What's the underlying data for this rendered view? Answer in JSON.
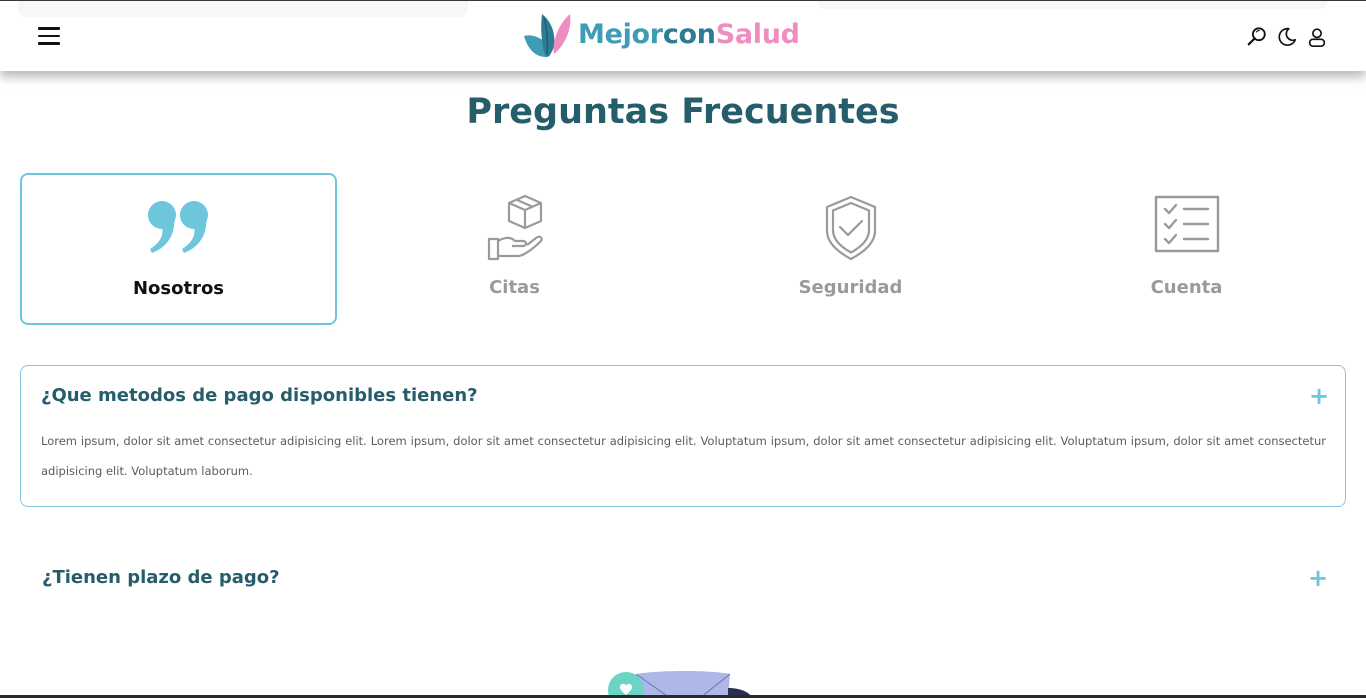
{
  "header": {
    "menu_icon": "hamburger-menu-icon",
    "logo": {
      "part1": "Mejor",
      "part2": "con",
      "part3": "Salud",
      "icon": "leaf-logo-icon"
    },
    "icons": [
      "search-icon",
      "moon-icon",
      "user-icon"
    ]
  },
  "page": {
    "title": "Preguntas Frecuentes"
  },
  "categories": [
    {
      "label": "Nosotros",
      "icon": "quote-icon",
      "active": true
    },
    {
      "label": "Citas",
      "icon": "hand-box-icon",
      "active": false
    },
    {
      "label": "Seguridad",
      "icon": "shield-check-icon",
      "active": false
    },
    {
      "label": "Cuenta",
      "icon": "checklist-icon",
      "active": false
    }
  ],
  "faqs": [
    {
      "question": "¿Que metodos de pago disponibles tienen?",
      "answer": "Lorem ipsum, dolor sit amet consectetur adipisicing elit. Lorem ipsum, dolor sit amet consectetur adipisicing elit. Voluptatum ipsum, dolor sit amet consectetur adipisicing elit. Voluptatum ipsum, dolor sit amet consectetur adipisicing elit. Voluptatum laborum.",
      "expanded": true,
      "toggle": "+"
    },
    {
      "question": "¿Tienen plazo de pago?",
      "expanded": false,
      "toggle": "+"
    }
  ],
  "colors": {
    "accent": "#6ec6dc",
    "title": "#255d6b",
    "logo_blue": "#3e9cb5",
    "logo_pink": "#ef8cc0",
    "inactive": "#9a9a9a"
  }
}
